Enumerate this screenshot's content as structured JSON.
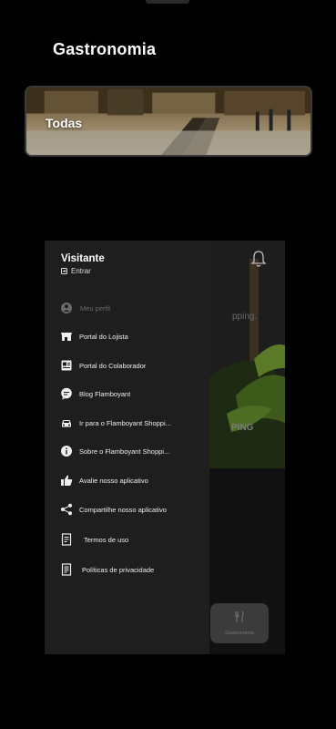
{
  "header": {
    "title": "Gastronomia"
  },
  "category_card": {
    "label": "Todas"
  },
  "preview": {
    "text_a": "pping.",
    "text_b": "PING",
    "card_label": "Gastronomia"
  },
  "drawer": {
    "user_name": "Visitante",
    "login_label": "Entrar",
    "items": [
      {
        "label": "Meu perfil",
        "icon": "profile-icon"
      },
      {
        "label": "Portal do Lojista",
        "icon": "store-icon"
      },
      {
        "label": "Portal do Colaborador",
        "icon": "badge-icon"
      },
      {
        "label": "Blog Flamboyant",
        "icon": "chat-icon"
      },
      {
        "label": "Ir para o Flamboyant Shoppi...",
        "icon": "car-icon"
      },
      {
        "label": "Sobre o Flamboyant Shoppi...",
        "icon": "info-icon"
      },
      {
        "label": "Avalie nosso aplicativo",
        "icon": "thumbs-up-icon"
      },
      {
        "label": "Compartilhe nosso aplicativo",
        "icon": "share-icon"
      },
      {
        "label": "Termos de uso",
        "icon": "document-icon"
      },
      {
        "label": "Políticas de privacidade",
        "icon": "policy-icon"
      }
    ]
  }
}
